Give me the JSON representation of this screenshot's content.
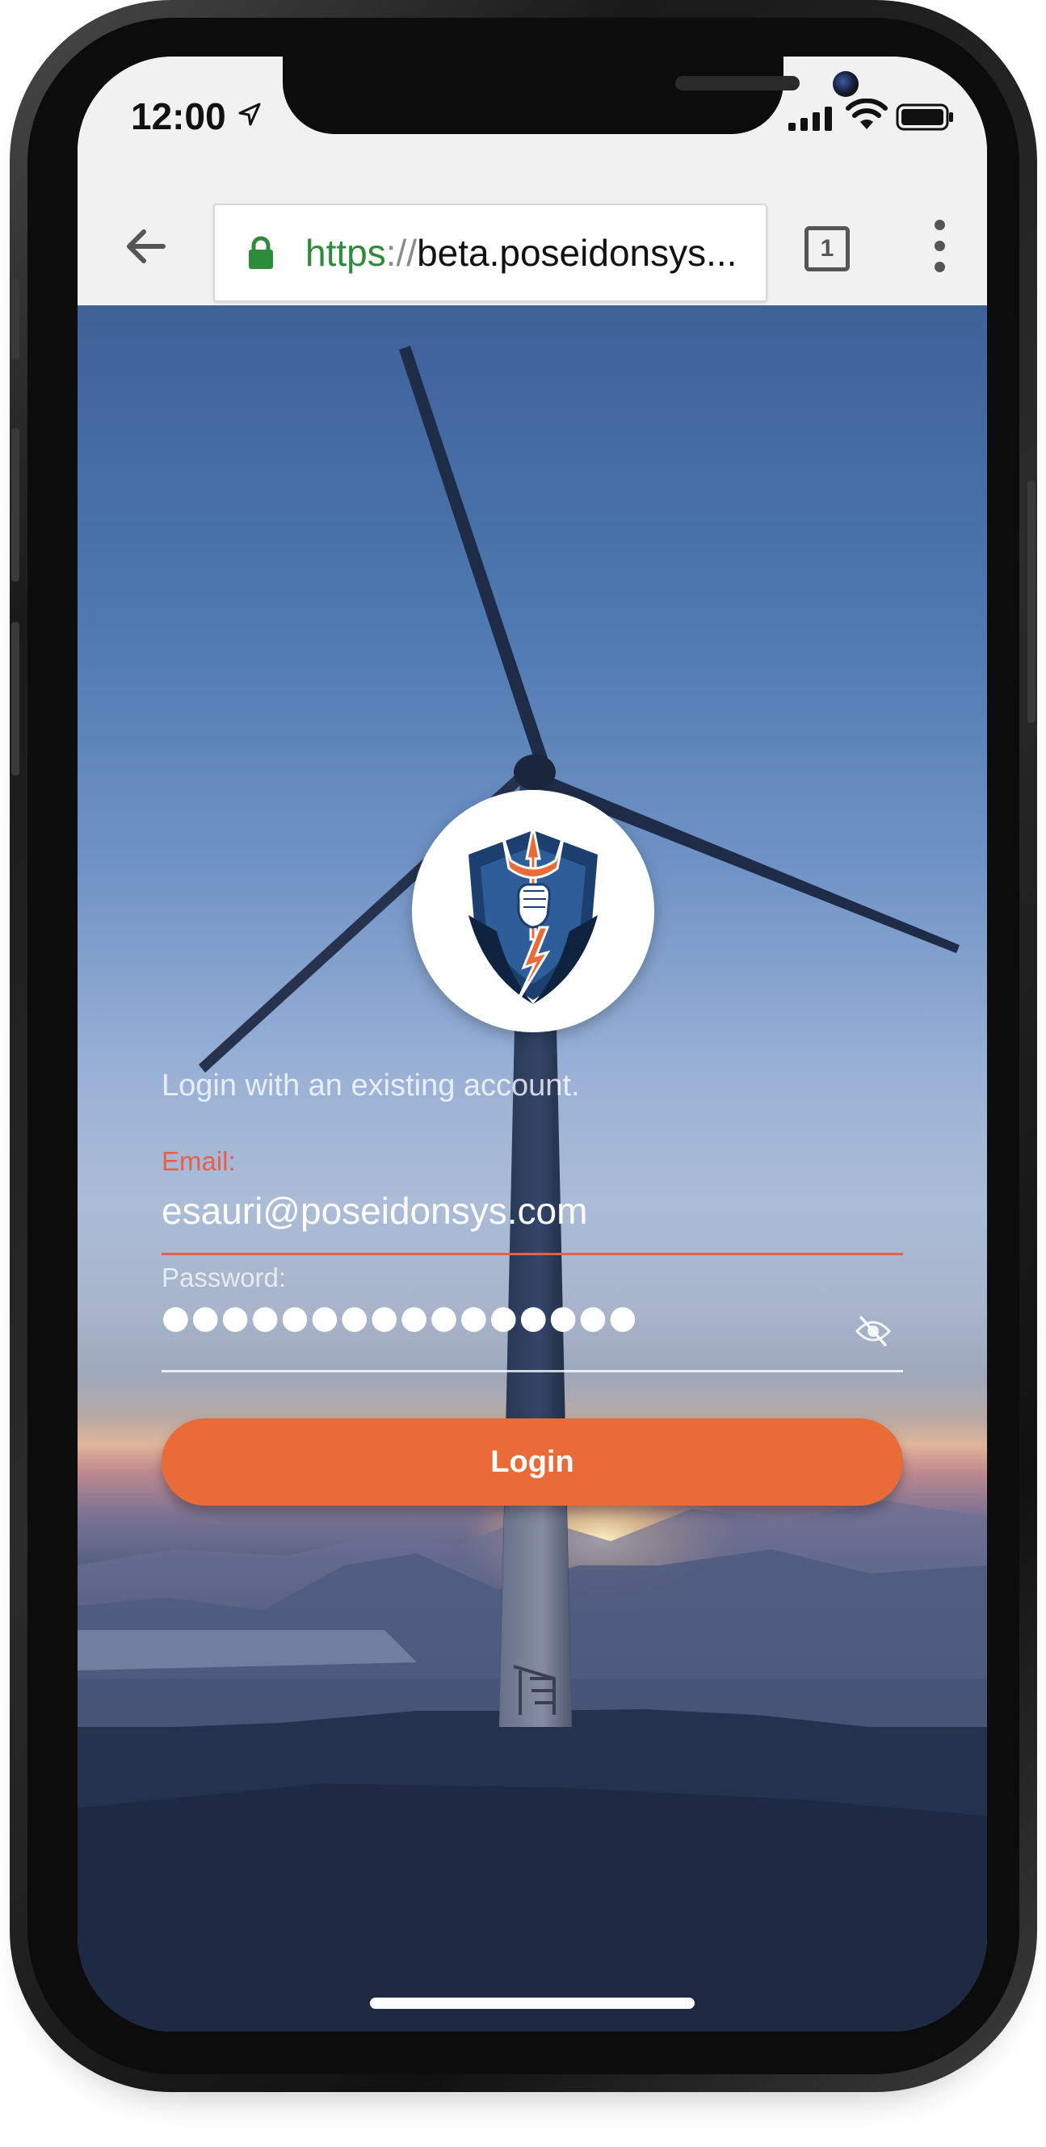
{
  "status_bar": {
    "time": "12:00"
  },
  "browser": {
    "url_scheme": "https",
    "url_separator": "://",
    "url_host": "beta.poseidonsys...",
    "tab_count": "1"
  },
  "login": {
    "intro": "Login with an existing account.",
    "email_label": "Email:",
    "email_value": "esauri@poseidonsys.com",
    "password_label": "Password:",
    "password_value": "●●●●●●●●●●●●●●●●",
    "button_label": "Login"
  },
  "colors": {
    "accent": "#e96c38",
    "error": "#e8604a",
    "secure_green": "#2e8b3a"
  },
  "icons": {
    "location": "location-arrow-icon",
    "signal": "cellular-signal-icon",
    "wifi": "wifi-icon",
    "battery": "battery-icon",
    "back": "back-arrow-icon",
    "lock": "lock-icon",
    "tabs": "tab-switcher-icon",
    "menu": "more-vertical-icon",
    "visibility": "eye-off-icon",
    "logo": "trident-shield-logo"
  }
}
